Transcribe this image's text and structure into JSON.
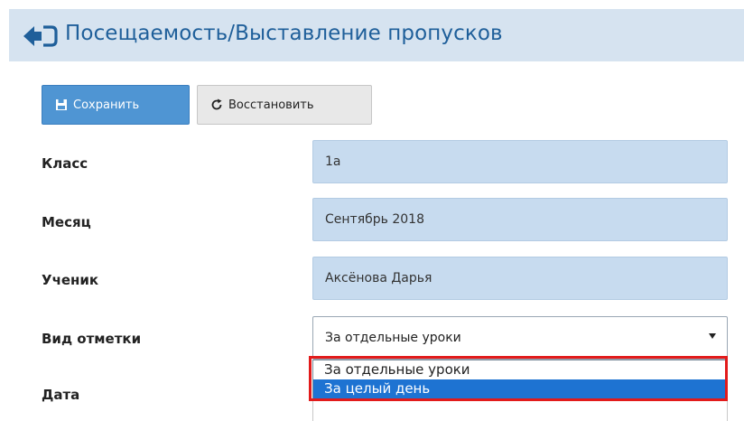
{
  "header": {
    "title": "Посещаемость/Выставление пропусков",
    "back_icon": "back-arrow-icon"
  },
  "toolbar": {
    "save_label": "Сохранить",
    "save_icon": "save-icon",
    "restore_label": "Восстановить",
    "restore_icon": "refresh-icon"
  },
  "form": {
    "class": {
      "label": "Класс",
      "value": "1а"
    },
    "month": {
      "label": "Месяц",
      "value": "Сентябрь 2018"
    },
    "student": {
      "label": "Ученик",
      "value": "Аксёнова Дарья"
    },
    "mark_type": {
      "label": "Вид отметки",
      "selected": "За отдельные уроки",
      "options": [
        "За отдельные уроки",
        "За целый день"
      ],
      "highlighted_option": "За целый день"
    },
    "date": {
      "label": "Дата",
      "value": ""
    }
  },
  "colors": {
    "header_bg": "#d6e3f0",
    "title": "#1f5f9a",
    "primary_button": "#4f95d3",
    "readonly_field": "#c7dbef",
    "option_highlight": "#1e73d2",
    "annotation_border": "#e21b1b"
  }
}
